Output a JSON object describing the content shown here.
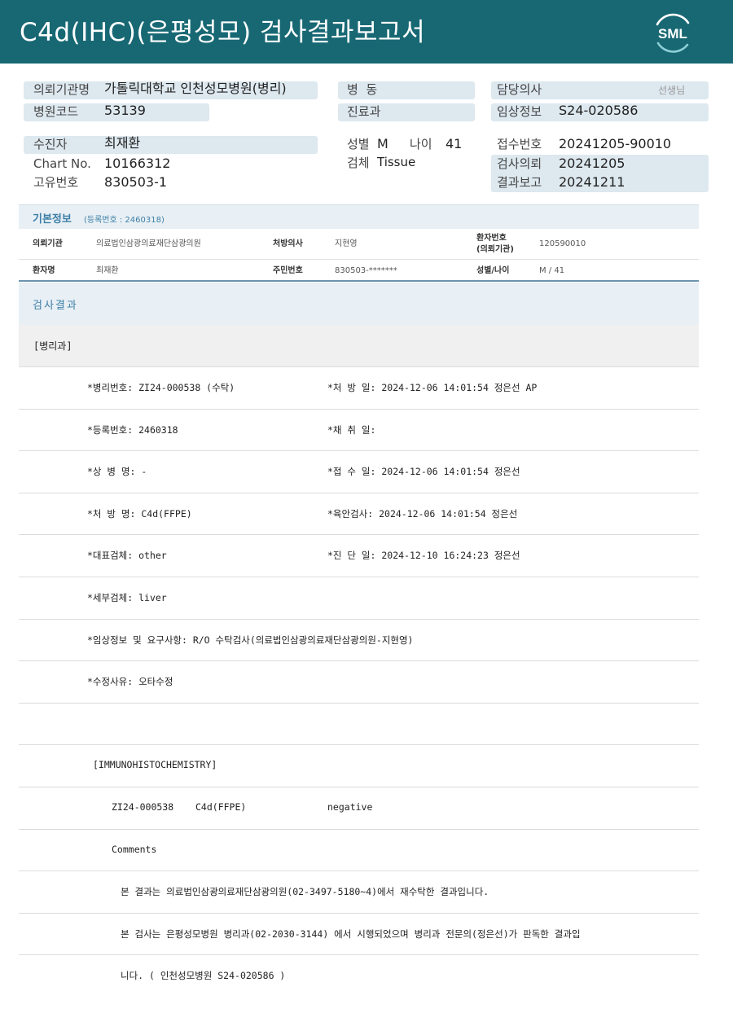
{
  "header": {
    "title": "C4d(IHC)(은평성모) 검사결과보고서",
    "logo_text": "SML",
    "background": "#186874"
  },
  "summary": {
    "institution_label": "의뢰기관명",
    "institution_value": "가톨릭대학교 인천성모병원(병리)",
    "ward_label": "병  동",
    "doctor_label": "담당의사",
    "doctor_value": "선생님",
    "hospital_code_label": "병원코드",
    "hospital_code_value": "53139",
    "department_label": "진료과",
    "clinical_info_label": "임상정보",
    "clinical_info_value": "S24-020586",
    "patient_label": "수진자",
    "patient_value": "최재환",
    "sex_label": "성별",
    "sex_value": "M",
    "age_label": "나이",
    "age_value": "41",
    "receipt_no_label": "접수번호",
    "receipt_no_value": "20241205-90010",
    "chart_no_label": "Chart No.",
    "chart_no_value": "10166312",
    "specimen_label": "검체",
    "specimen_value": "Tissue",
    "request_date_label": "검사의뢰",
    "request_date_value": "20241205",
    "unique_no_label": "고유번호",
    "unique_no_value": "830503-1",
    "report_date_label": "결과보고",
    "report_date_value": "20241211"
  },
  "basic_info": {
    "title": "기본정보",
    "subtitle": "(등록번호 : 2460318)",
    "row1": {
      "institution_label": "의뢰기관",
      "institution_value": "의료법인삼광의료재단삼광의원",
      "prescriber_label": "처방의사",
      "prescriber_value": "지현영",
      "patient_no_label_1": "환자번호",
      "patient_no_label_2": "(의뢰기관)",
      "patient_no_value": "120590010"
    },
    "row2": {
      "name_label": "환자명",
      "name_value": "최재환",
      "rrn_label": "주민번호",
      "rrn_value": "830503-*******",
      "sex_age_label": "성별/나이",
      "sex_age_value": "M / 41"
    }
  },
  "result": {
    "title": "검사결과",
    "department": "[병리과]",
    "rows": [
      {
        "left": "*병리번호: ZI24-000538 (수탁)",
        "right": "*처 방 일: 2024-12-06 14:01:54  정은선 AP"
      },
      {
        "left": "*등록번호: 2460318",
        "right": "*채 취 일:"
      },
      {
        "left": "*상 병 명: -",
        "right": "*접 수 일: 2024-12-06 14:01:54  정은선"
      },
      {
        "left": "*처 방 명: C4d(FFPE)",
        "right": "*육안검사: 2024-12-06 14:01:54  정은선"
      },
      {
        "left": "*대표검체: other",
        "right": "*진 단 일: 2024-12-10 16:24:23  정은선"
      },
      {
        "left": "*세부검체: liver",
        "right": ""
      },
      {
        "left": "*임상정보 및 요구사항: R/O 수탁검사(의료법인삼광의료재단삼광의원-지현영)",
        "right": ""
      },
      {
        "left": "*수정사유: 오타수정",
        "right": ""
      },
      {
        "left": "",
        "right": ""
      }
    ],
    "ihc_header": "[IMMUNOHISTOCHEMISTRY]",
    "ihc_case": "ZI24-000538",
    "ihc_test": "C4d(FFPE)",
    "ihc_result": "negative",
    "comments_label": "Comments",
    "comment_1": "본 결과는 의료법인삼광의료재단삼광의원(02-3497-5180~4)에서 재수탁한 결과입니다.",
    "comment_2": "본 검사는 은평성모병원 병리과(02-2030-3144) 에서 시행되었으며 병리과 전문의(정은선)가 판독한 결과입",
    "comment_3": "니다. ( 인천성모병원 S24-020586 )"
  }
}
